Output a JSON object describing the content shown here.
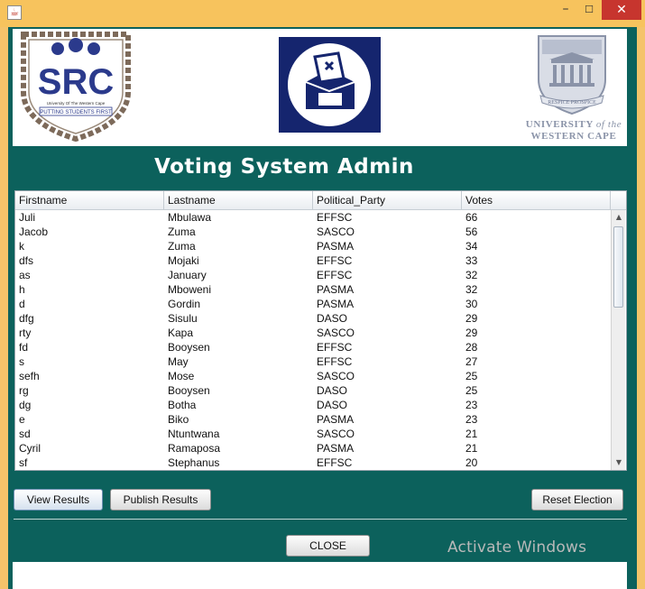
{
  "window": {
    "app_icon": "java-icon",
    "minimize_glyph": "–",
    "maximize_glyph": "☐",
    "close_glyph": "✕"
  },
  "header": {
    "src_logo": {
      "text": "SRC",
      "subtitle": "University Of The Western Cape",
      "motto": "PUTTING STUDENTS FIRST"
    },
    "ballot_logo": "ballot-box-icon",
    "uwc_logo": {
      "crest_motto": "RESPICE PROSPICE",
      "name_line1_a": "UNIVERSITY",
      "name_line1_b": "of the",
      "name_line2": "WESTERN CAPE"
    }
  },
  "title": "Voting System Admin",
  "table": {
    "columns": [
      "Firstname",
      "Lastname",
      "Political_Party",
      "Votes"
    ],
    "rows": [
      [
        "Juli",
        "Mbulawa",
        "EFFSC",
        "66"
      ],
      [
        "Jacob",
        "Zuma",
        "SASCO",
        "56"
      ],
      [
        "k",
        "Zuma",
        "PASMA",
        "34"
      ],
      [
        "dfs",
        "Mojaki",
        "EFFSC",
        "33"
      ],
      [
        "as",
        "January",
        "EFFSC",
        "32"
      ],
      [
        "h",
        "Mboweni",
        "PASMA",
        "32"
      ],
      [
        "d",
        "Gordin",
        "PASMA",
        "30"
      ],
      [
        "dfg",
        "Sisulu",
        "DASO",
        "29"
      ],
      [
        "rty",
        "Kapa",
        "SASCO",
        "29"
      ],
      [
        "fd",
        "Booysen",
        "EFFSC",
        "28"
      ],
      [
        "s",
        "May",
        "EFFSC",
        "27"
      ],
      [
        "sefh",
        "Mose",
        "SASCO",
        "25"
      ],
      [
        "rg",
        "Booysen",
        "DASO",
        "25"
      ],
      [
        "dg",
        "Botha",
        "DASO",
        "23"
      ],
      [
        "e",
        "Biko",
        "PASMA",
        "23"
      ],
      [
        "sd",
        "Ntuntwana",
        "SASCO",
        "21"
      ],
      [
        "Cyril",
        "Ramaposa",
        "PASMA",
        "21"
      ],
      [
        "sf",
        "Stephanus",
        "EFFSC",
        "20"
      ]
    ]
  },
  "buttons": {
    "view_results": "View Results",
    "publish_results": "Publish Results",
    "reset_election": "Reset Election",
    "close": "CLOSE"
  },
  "watermark": "Activate Windows",
  "colors": {
    "background": "#0c615c",
    "title_bar": "#f7c35d",
    "close_button": "#c7352e",
    "ballot_logo": "#15256e",
    "src_text": "#2b3a8c"
  }
}
